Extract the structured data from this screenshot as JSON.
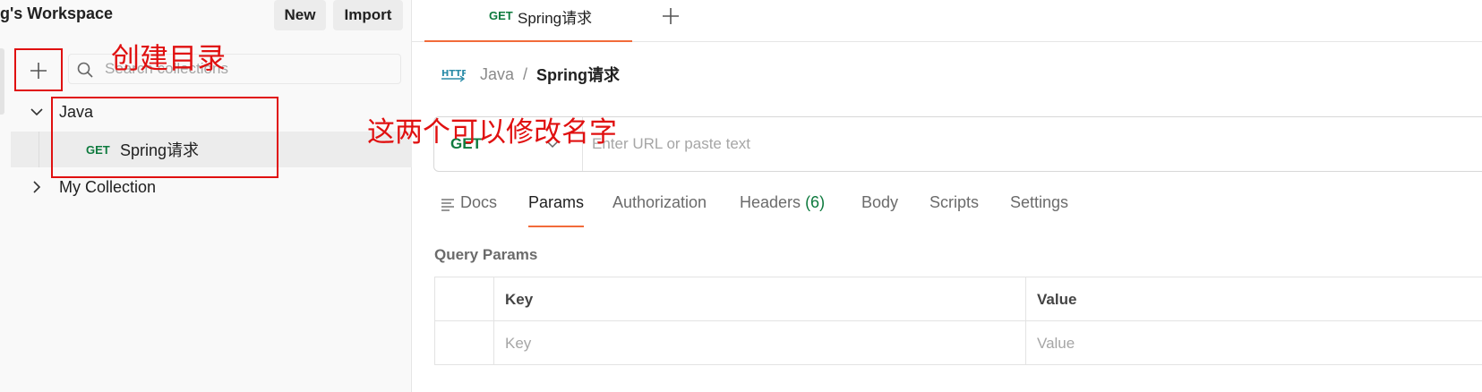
{
  "workspace": {
    "title": "g's Workspace",
    "new_label": "New",
    "import_label": "Import"
  },
  "sidebar": {
    "search_placeholder": "Search collections",
    "tree": [
      {
        "label": "Java",
        "expanded": true
      },
      {
        "method": "GET",
        "label": "Spring请求",
        "selected": true
      },
      {
        "label": "My Collection",
        "expanded": false
      }
    ]
  },
  "annotations": {
    "create_dir": "创建目录",
    "rename_hint": "这两个可以修改名字"
  },
  "tabs": [
    {
      "method": "GET",
      "label": "Spring请求"
    }
  ],
  "breadcrumb": {
    "icon": "HTTP",
    "parent": "Java",
    "separator": "/",
    "current": "Spring请求"
  },
  "request": {
    "method": "GET",
    "url_placeholder": "Enter URL or paste text"
  },
  "request_tabs": {
    "docs": "Docs",
    "params": "Params",
    "authorization": "Authorization",
    "headers": "Headers",
    "headers_count": "(6)",
    "body": "Body",
    "scripts": "Scripts",
    "settings": "Settings"
  },
  "query_params": {
    "title": "Query Params",
    "header": {
      "key": "Key",
      "value": "Value"
    },
    "placeholder": {
      "key": "Key",
      "value": "Value"
    }
  },
  "colors": {
    "accent": "#f26b3a",
    "get": "#0e7a3e",
    "annotation": "#e01010"
  }
}
